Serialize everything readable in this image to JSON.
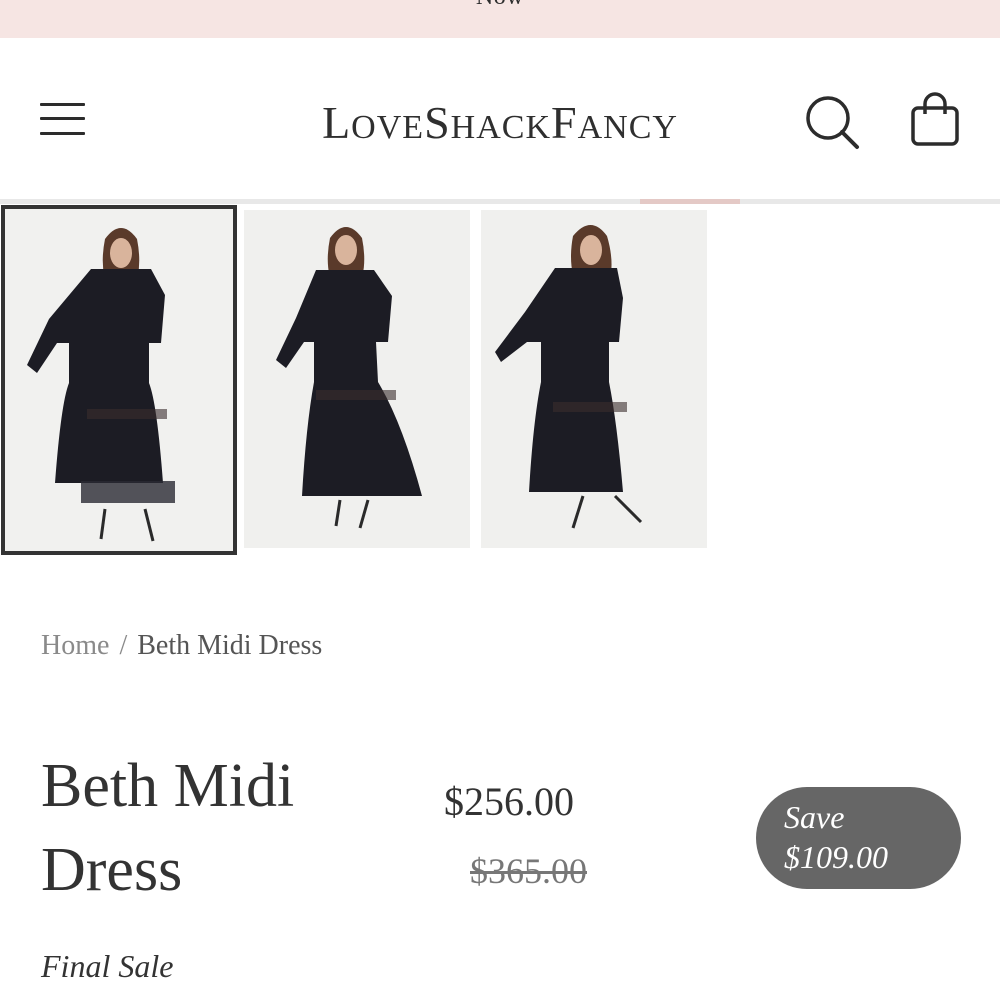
{
  "promo": {
    "text": "Now"
  },
  "header": {
    "brand": {
      "l1": "L",
      "r1": "OVE",
      "l2": "S",
      "r2": "HACK",
      "l3": "F",
      "r3": "ANCY"
    },
    "menu_icon": "hamburger-menu-icon",
    "search_icon": "search-icon",
    "cart_icon": "shopping-bag-icon"
  },
  "gallery": {
    "selected_index": 0,
    "thumbnails": [
      {
        "name": "front view"
      },
      {
        "name": "walking view"
      },
      {
        "name": "side view"
      }
    ]
  },
  "breadcrumb": {
    "home": "Home",
    "separator": "/",
    "current": "Beth Midi Dress"
  },
  "product": {
    "title": "Beth Midi Dress",
    "price": "$256.00",
    "compare_at_price": "$365.00",
    "save_label": "Save",
    "save_amount": "$109.00",
    "sale_note": "Final Sale"
  },
  "colors": {
    "promo_bg": "#f6e5e3",
    "badge_bg": "#666666",
    "dress": "#1c1c24"
  }
}
